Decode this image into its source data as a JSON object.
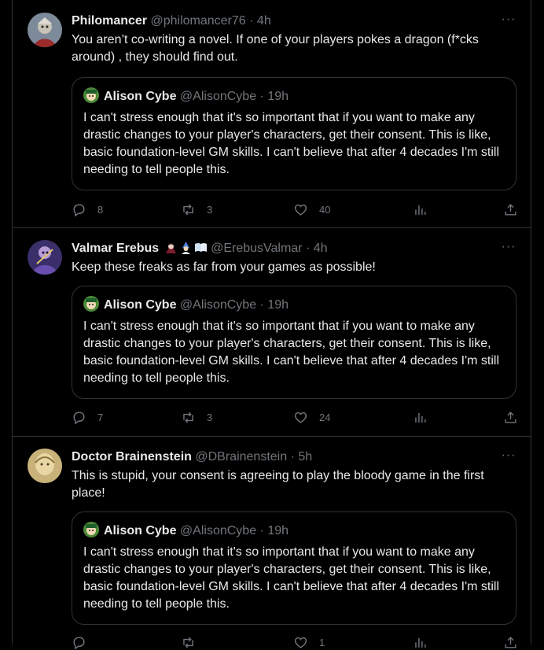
{
  "tweets": [
    {
      "name": "Philomancer",
      "handle": "@philomancer76",
      "dot": "·",
      "time": "4h",
      "more": "···",
      "text": "You aren’t co-writing a novel. If one of your players pokes a dragon (f*cks around) , they should find out.",
      "quote": {
        "name": "Alison Cybe",
        "handle": "@AlisonCybe",
        "dot": "·",
        "time": "19h",
        "text": "I can't stress enough that it's so important that if you want to make any drastic changes to your player's characters, get their consent. This is like, basic foundation-level GM skills. I can't believe that after 4 decades I'm still needing to tell people this."
      },
      "replies": "8",
      "retweets": "3",
      "likes": "40",
      "views": ""
    },
    {
      "name": "Valmar Erebus",
      "handle": "@ErebusValmar",
      "dot": "·",
      "time": "4h",
      "more": "···",
      "text": "Keep these freaks as far from your games as possible!",
      "quote": {
        "name": "Alison Cybe",
        "handle": "@AlisonCybe",
        "dot": "·",
        "time": "19h",
        "text": "I can't stress enough that it's so important that if you want to make any drastic changes to your player's characters, get their consent. This is like, basic foundation-level GM skills. I can't believe that after 4 decades I'm still needing to tell people this."
      },
      "replies": "7",
      "retweets": "3",
      "likes": "24",
      "views": ""
    },
    {
      "name": "Doctor Brainenstein",
      "handle": "@DBrainenstein",
      "dot": "·",
      "time": "5h",
      "more": "···",
      "text": "This is stupid, your consent is agreeing to play the bloody game in the first place!",
      "quote": {
        "name": "Alison Cybe",
        "handle": "@AlisonCybe",
        "dot": "·",
        "time": "19h",
        "text": "I can't stress enough that it's so important that if you want to make any drastic changes to your player's characters, get their consent. This is like, basic foundation-level GM skills. I can't believe that after 4 decades I'm still needing to tell people this."
      },
      "replies": "",
      "retweets": "",
      "likes": "1",
      "views": ""
    }
  ],
  "icons": {
    "reply": "reply-icon",
    "retweet": "retweet-icon",
    "like": "heart-icon",
    "views": "views-icon",
    "share": "share-icon"
  },
  "colors": {
    "background": "#000000",
    "text": "#e7e9ea",
    "muted": "#71767b",
    "border": "#2f3336"
  }
}
